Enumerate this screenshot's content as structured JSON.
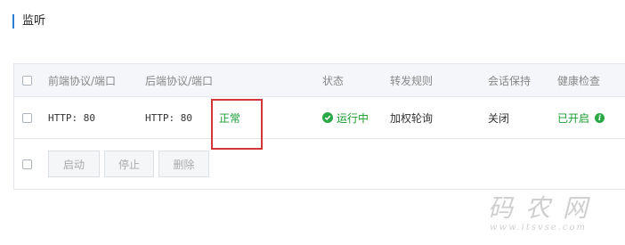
{
  "section": {
    "title": "监听"
  },
  "table": {
    "headers": [
      "前端协议/端口",
      "后端协议/端口",
      "状态",
      "转发规则",
      "会话保持",
      "健康检查"
    ],
    "rows": [
      {
        "frontend": "HTTP:  80",
        "backend": "HTTP:  80",
        "note": "正常",
        "status": "运行中",
        "rule": "加权轮询",
        "session": "关闭",
        "health": "已开启"
      }
    ]
  },
  "actions": {
    "start": "启动",
    "stop": "停止",
    "delete": "删除"
  },
  "watermark": {
    "main": "码农网",
    "url": "www.itsvse.com"
  },
  "colors": {
    "accent": "#2a7fd1",
    "success": "#1a9b32",
    "highlight": "#d3373a"
  },
  "icons": {
    "status": "check-circle-icon",
    "health": "info-icon"
  }
}
